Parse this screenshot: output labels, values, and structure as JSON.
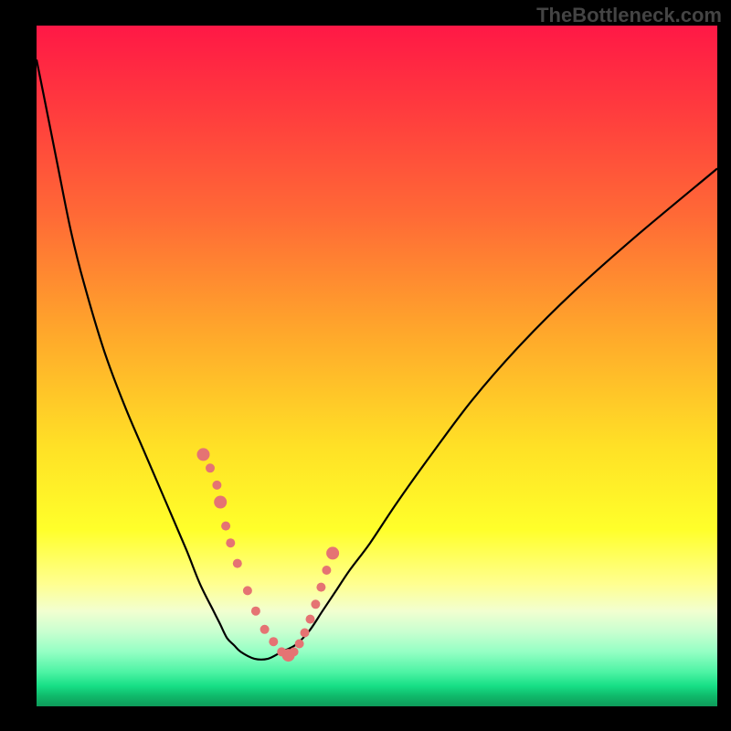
{
  "watermark": "TheBottleneck.com",
  "colors": {
    "background": "#000000",
    "curve_stroke": "#000000",
    "marker_fill": "#e57373",
    "gradient_top": "#ff1846",
    "gradient_mid_orange": "#ffa72b",
    "gradient_yellow": "#ffff2a",
    "gradient_green": "#17df86",
    "gradient_bottom": "#0e9b5a"
  },
  "chart_data": {
    "type": "line",
    "title": "",
    "xlabel": "",
    "ylabel": "",
    "xlim": [
      0,
      100
    ],
    "ylim": [
      0,
      100
    ],
    "curve": {
      "x": [
        0,
        1,
        3,
        5,
        7,
        10,
        13,
        16,
        19,
        22,
        24,
        26,
        27,
        28,
        29,
        30,
        32,
        34,
        36,
        38,
        40,
        42,
        44,
        46,
        49,
        53,
        58,
        64,
        71,
        79,
        88,
        100
      ],
      "y": [
        5,
        10,
        20,
        30,
        38,
        48,
        56,
        63,
        70,
        77,
        82,
        86,
        88,
        90,
        91,
        92,
        93,
        93,
        92,
        91,
        89,
        86,
        83,
        80,
        76,
        70,
        63,
        55,
        47,
        39,
        31,
        21
      ]
    },
    "markers": {
      "x": [
        24.5,
        25.5,
        26.5,
        27.0,
        27.8,
        28.5,
        29.5,
        31.0,
        32.2,
        33.5,
        34.8,
        36.0,
        37.0,
        37.8,
        38.6,
        39.4,
        40.2,
        41.0,
        41.8,
        42.6,
        43.5
      ],
      "y": [
        63.0,
        65.0,
        67.5,
        70.0,
        73.5,
        76.0,
        79.0,
        83.0,
        86.0,
        88.7,
        90.5,
        92.0,
        92.5,
        92.0,
        90.8,
        89.2,
        87.2,
        85.0,
        82.5,
        80.0,
        77.5
      ],
      "r_small": 5,
      "r_large": 7,
      "large_indices": [
        0,
        3,
        12,
        20
      ]
    }
  }
}
